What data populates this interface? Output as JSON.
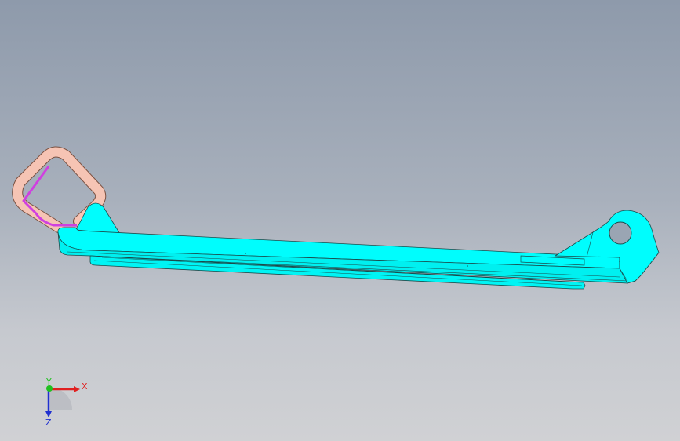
{
  "viewport": {
    "background_top": "#8e9aab",
    "background_bottom": "#d0d1d4"
  },
  "model": {
    "body_color": "#00fdfd",
    "edge_color": "#1a4a4a",
    "handle_outer_color": "#f6c4b4",
    "handle_inner_color": "#d040e0"
  },
  "triad": {
    "x_label": "X",
    "y_label": "Y",
    "z_label": "Z",
    "x_color": "#e02020",
    "y_color": "#20c020",
    "z_color": "#2030d0"
  }
}
